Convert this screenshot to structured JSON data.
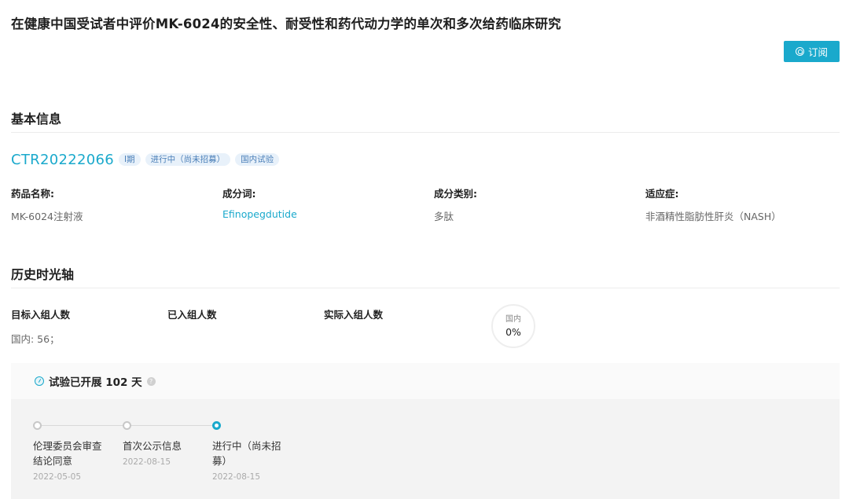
{
  "page": {
    "title": "在健康中国受试者中评价MK-6024的安全性、耐受性和药代动力学的单次和多次给药临床研究",
    "subscribe_label": "订阅"
  },
  "basic_info": {
    "section_title": "基本信息",
    "trial_id": "CTR20222066",
    "tags": [
      "I期",
      "进行中（尚未招募）",
      "国内试验"
    ],
    "fields": [
      {
        "label": "药品名称:",
        "value": "MK-6024注射液"
      },
      {
        "label": "成分词:",
        "value": "Efinopegdutide"
      },
      {
        "label": "成分类别:",
        "value": "多肽"
      },
      {
        "label": "适应症:",
        "value": "非酒精性脂肪性肝炎（NASH）"
      }
    ]
  },
  "history": {
    "section_title": "历史时光轴",
    "stats": [
      {
        "label": "目标入组人数",
        "value": "国内: 56；"
      },
      {
        "label": "已入组人数",
        "value": ""
      },
      {
        "label": "实际入组人数",
        "value": ""
      }
    ],
    "progress": {
      "label": "国内",
      "value": "0%"
    },
    "days_text": "试验已开展 102 天",
    "help_glyph": "?",
    "timeline": [
      {
        "title": "伦理委员会审查结论同意",
        "date": "2022-05-05",
        "active": false
      },
      {
        "title": "首次公示信息",
        "date": "2022-08-15",
        "active": false
      },
      {
        "title": "进行中（尚未招募）",
        "date": "2022-08-15",
        "active": true
      }
    ]
  },
  "colors": {
    "accent": "#1aa9cc",
    "tag_text": "#4a7fb8",
    "tag_bg": "#e8f1fa"
  },
  "icons": {
    "subscribe": "bell-circle-icon",
    "days": "clock-icon",
    "help": "question-icon"
  }
}
